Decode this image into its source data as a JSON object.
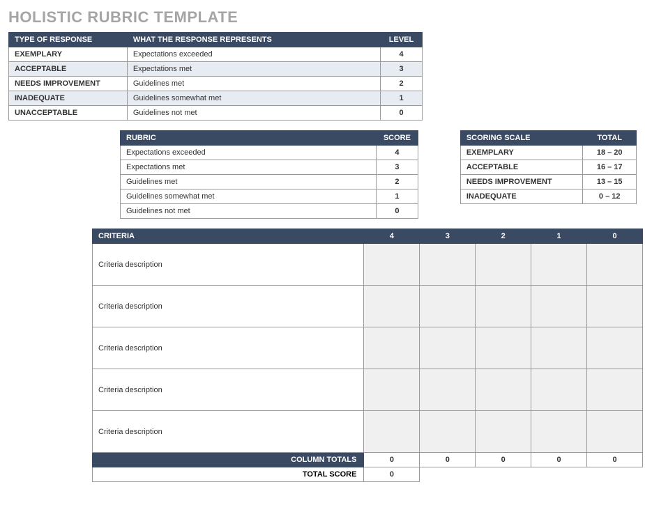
{
  "title": "HOLISTIC RUBRIC TEMPLATE",
  "response_table": {
    "headers": {
      "type": "TYPE OF RESPONSE",
      "represents": "WHAT THE RESPONSE REPRESENTS",
      "level": "LEVEL"
    },
    "rows": [
      {
        "type": "EXEMPLARY",
        "represents": "Expectations exceeded",
        "level": "4"
      },
      {
        "type": "ACCEPTABLE",
        "represents": "Expectations met",
        "level": "3"
      },
      {
        "type": "NEEDS IMPROVEMENT",
        "represents": "Guidelines met",
        "level": "2"
      },
      {
        "type": "INADEQUATE",
        "represents": "Guidelines somewhat met",
        "level": "1"
      },
      {
        "type": "UNACCEPTABLE",
        "represents": "Guidelines not met",
        "level": "0"
      }
    ]
  },
  "rubric_table": {
    "headers": {
      "rubric": "RUBRIC",
      "score": "SCORE"
    },
    "rows": [
      {
        "rubric": "Expectations exceeded",
        "score": "4"
      },
      {
        "rubric": "Expectations met",
        "score": "3"
      },
      {
        "rubric": "Guidelines met",
        "score": "2"
      },
      {
        "rubric": "Guidelines somewhat met",
        "score": "1"
      },
      {
        "rubric": "Guidelines not met",
        "score": "0"
      }
    ]
  },
  "scoring_table": {
    "headers": {
      "scale": "SCORING SCALE",
      "total": "TOTAL"
    },
    "rows": [
      {
        "scale": "EXEMPLARY",
        "total": "18 – 20"
      },
      {
        "scale": "ACCEPTABLE",
        "total": "16 – 17"
      },
      {
        "scale": "NEEDS IMPROVEMENT",
        "total": "13 – 15"
      },
      {
        "scale": "INADEQUATE",
        "total": "0 – 12"
      }
    ]
  },
  "criteria_table": {
    "headers": {
      "criteria": "CRITERIA",
      "s4": "4",
      "s3": "3",
      "s2": "2",
      "s1": "1",
      "s0": "0"
    },
    "rows": [
      {
        "desc": "Criteria description"
      },
      {
        "desc": "Criteria description"
      },
      {
        "desc": "Criteria description"
      },
      {
        "desc": "Criteria description"
      },
      {
        "desc": "Criteria description"
      }
    ],
    "totals": {
      "label": "COLUMN TOTALS",
      "s4": "0",
      "s3": "0",
      "s2": "0",
      "s1": "0",
      "s0": "0"
    },
    "total_score": {
      "label": "TOTAL SCORE",
      "value": "0"
    }
  }
}
